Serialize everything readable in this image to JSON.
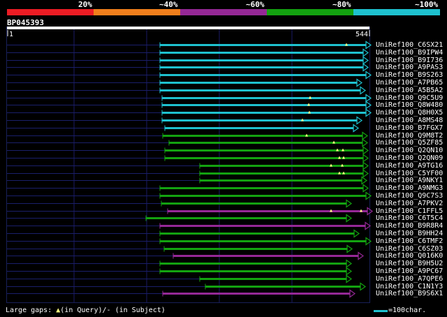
{
  "legend": {
    "labels": [
      "20%",
      "~40%",
      "~60%",
      "~80%",
      "~100%"
    ],
    "colors": [
      "#ec1c24",
      "#f07f1c",
      "#952896",
      "#13a210",
      "#1ec1cf"
    ]
  },
  "query": {
    "id": "BP045393",
    "start": "1",
    "end": "544"
  },
  "hits": [
    {
      "name": "UniRef100_C6SX21",
      "qs": 229,
      "qe": 524,
      "color": "#1ec1cf",
      "gaps": [
        496
      ]
    },
    {
      "name": "UniRef100_B9IPW4",
      "qs": 229,
      "qe": 520,
      "color": "#1ec1cf",
      "gaps": []
    },
    {
      "name": "UniRef100_B9I736",
      "qs": 229,
      "qe": 520,
      "color": "#1ec1cf",
      "gaps": []
    },
    {
      "name": "UniRef100_A9PAS3",
      "qs": 229,
      "qe": 520,
      "color": "#1ec1cf",
      "gaps": []
    },
    {
      "name": "UniRef100_B9S263",
      "qs": 229,
      "qe": 524,
      "color": "#1ec1cf",
      "gaps": []
    },
    {
      "name": "UniRef100_A7PB65",
      "qs": 229,
      "qe": 511,
      "color": "#1ec1cf",
      "gaps": []
    },
    {
      "name": "UniRef100_A5B5A2",
      "qs": 229,
      "qe": 516,
      "color": "#1ec1cf",
      "gaps": []
    },
    {
      "name": "UniRef100_Q9C5U9",
      "qs": 232,
      "qe": 524,
      "color": "#1ec1cf",
      "gaps": [
        444
      ]
    },
    {
      "name": "UniRef100_Q8W480",
      "qs": 232,
      "qe": 524,
      "color": "#1ec1cf",
      "gaps": [
        442
      ]
    },
    {
      "name": "UniRef100_Q8H0X5",
      "qs": 232,
      "qe": 524,
      "color": "#1ec1cf",
      "gaps": [
        443
      ]
    },
    {
      "name": "UniRef100_A8MS48",
      "qs": 232,
      "qe": 511,
      "color": "#1ec1cf",
      "gaps": [
        433
      ]
    },
    {
      "name": "UniRef100_B7FGX7",
      "qs": 236,
      "qe": 506,
      "color": "#1ec1cf",
      "gaps": []
    },
    {
      "name": "UniRef100_Q9M8T2",
      "qs": 233,
      "qe": 519,
      "color": "#13a210",
      "gaps": [
        439
      ]
    },
    {
      "name": "UniRef100_Q5ZF85",
      "qs": 242,
      "qe": 519,
      "color": "#13a210",
      "gaps": [
        478
      ]
    },
    {
      "name": "UniRef100_Q2QN10",
      "qs": 236,
      "qe": 520,
      "color": "#13a210",
      "gaps": [
        483,
        491
      ]
    },
    {
      "name": "UniRef100_Q2QN09",
      "qs": 236,
      "qe": 520,
      "color": "#13a210",
      "gaps": [
        486,
        492
      ]
    },
    {
      "name": "UniRef100_A9TG16",
      "qs": 286,
      "qe": 520,
      "color": "#13a210",
      "gaps": [
        474,
        490
      ]
    },
    {
      "name": "UniRef100_C5YF00",
      "qs": 286,
      "qe": 520,
      "color": "#13a210",
      "gaps": [
        486,
        492
      ]
    },
    {
      "name": "UniRef100_A9NKY1",
      "qs": 286,
      "qe": 518,
      "color": "#13a210",
      "gaps": []
    },
    {
      "name": "UniRef100_A9NMG3",
      "qs": 229,
      "qe": 520,
      "color": "#13a210",
      "gaps": []
    },
    {
      "name": "UniRef100_Q9C7S3",
      "qs": 229,
      "qe": 524,
      "color": "#13a210",
      "gaps": []
    },
    {
      "name": "UniRef100_A7PKV2",
      "qs": 231,
      "qe": 496,
      "color": "#13a210",
      "gaps": []
    },
    {
      "name": "UniRef100_C1FFL5",
      "qs": 240,
      "qe": 526,
      "color": "#952896",
      "gaps": [
        474,
        517
      ]
    },
    {
      "name": "UniRef100_C6T5C4",
      "qs": 209,
      "qe": 496,
      "color": "#13a210",
      "gaps": []
    },
    {
      "name": "UniRef100_B9R8R4",
      "qs": 229,
      "qe": 523,
      "color": "#952896",
      "gaps": []
    },
    {
      "name": "UniRef100_B9HH24",
      "qs": 229,
      "qe": 507,
      "color": "#13a210",
      "gaps": []
    },
    {
      "name": "UniRef100_C6TMF2",
      "qs": 229,
      "qe": 524,
      "color": "#13a210",
      "gaps": []
    },
    {
      "name": "UniRef100_C6SZ03",
      "qs": 235,
      "qe": 497,
      "color": "#13a210",
      "gaps": []
    },
    {
      "name": "UniRef100_Q016K0",
      "qs": 248,
      "qe": 513,
      "color": "#952896",
      "gaps": []
    },
    {
      "name": "UniRef100_B9H5U2",
      "qs": 229,
      "qe": 496,
      "color": "#13a210",
      "gaps": []
    },
    {
      "name": "UniRef100_A9PC67",
      "qs": 229,
      "qe": 496,
      "color": "#13a210",
      "gaps": []
    },
    {
      "name": "UniRef100_A7QPE6",
      "qs": 286,
      "qe": 496,
      "color": "#13a210",
      "gaps": []
    },
    {
      "name": "UniRef100_C1N1Y3",
      "qs": 294,
      "qe": 516,
      "color": "#13a210",
      "gaps": []
    },
    {
      "name": "UniRef100_B9S6X1",
      "qs": 233,
      "qe": 501,
      "color": "#952896",
      "gaps": []
    }
  ],
  "footer": {
    "gaps_prefix": "Large gaps: ",
    "gaps_in_query": "(in Query)/",
    "gaps_dash": "-",
    "gaps_in_subject": " (in Subject)",
    "scale_label": "=100char."
  },
  "colors": {
    "frame": "#182058",
    "gridline": "#1a1a66",
    "query_line": "#ffffff",
    "gap_marker": "#ffff80"
  }
}
